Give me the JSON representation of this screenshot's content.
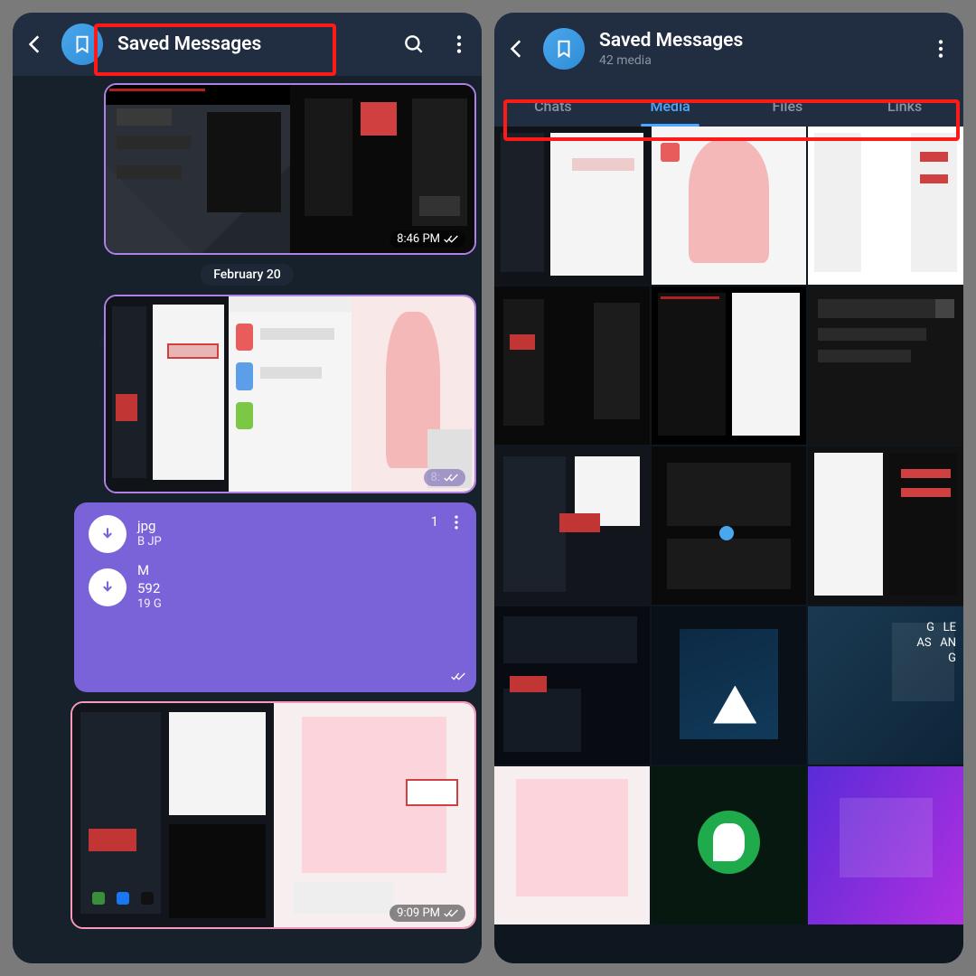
{
  "left": {
    "title": "Saved Messages",
    "date_separator": "February 20",
    "msg1_time": "8:46 PM",
    "file_block": {
      "line1a": "jpg",
      "line1b": "B JP",
      "line2a": "M",
      "count1": "1",
      "num": "592",
      "meta": "19        G"
    },
    "msg3_time": "9:09 PM"
  },
  "right": {
    "title": "Saved Messages",
    "subtitle": "42 media",
    "tabs": [
      "Chats",
      "Media",
      "Files",
      "Links"
    ],
    "active_tab": 1
  },
  "colors": {
    "accent": "#4da6ff",
    "highlight": "#ff1a1a"
  }
}
